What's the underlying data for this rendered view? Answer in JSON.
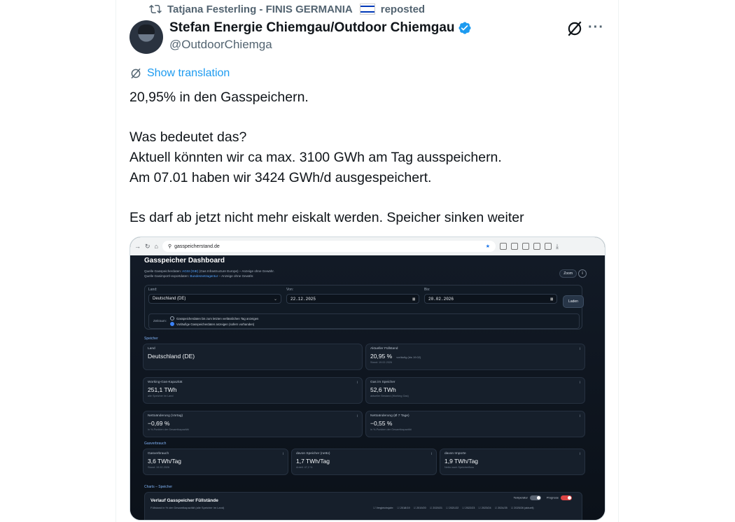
{
  "repost": {
    "text": "Tatjana Festerling - FINIS GERMANIA",
    "suffix": "reposted"
  },
  "author": {
    "name": "Stefan Energie Chiemgau/Outdoor Chiemgau",
    "handle": "@OutdoorChiemga"
  },
  "translate_label": "Show translation",
  "tweet": {
    "line1": "20,95% in den Gasspeichern.",
    "line2": "Was bedeutet das?",
    "line3": "Aktuell könnten wir ca max. 3100 GWh am Tag ausspeichern.",
    "line4": "Am 07.01 haben wir 3424 GWh/d ausgespeichert.",
    "line5": "Es darf ab jetzt nicht mehr eiskalt werden. Speicher sinken weiter"
  },
  "media": {
    "url": "gasspeicherstand.de",
    "dashboard": {
      "title": "Gasspeicher Dashboard",
      "source1_prefix": "Quelle Gasspeicherdaten:",
      "source1_link": "AGSI (GIE)",
      "source1_suffix": "(Gas Infrastructure Europe) – Anzeige ohne Gewähr.",
      "source2_prefix": "Quelle Gasimport/-exportdaten:",
      "source2_link": "Bundesnetzagentur",
      "source2_suffix": "– Anzeige ohne Gewähr.",
      "zoom": "Zoom",
      "filter": {
        "land_label": "Land:",
        "land_value": "Deutschland (DE)",
        "von_label": "Von:",
        "von_value": "22.12.2025",
        "bis_label": "Bis:",
        "bis_value": "20.02.2026",
        "load": "Laden",
        "zeitraum": "Zeitraum:",
        "opt1": "Gasspeicherdaten bis zum letzten verlässlichen Tag anzeigen",
        "opt2": "Vorläufige Gasspeicherdaten anzeigen (sofern vorhanden)"
      },
      "section_speicher": "Speicher",
      "cards": [
        {
          "title": "Land",
          "value": "Deutschland (DE)",
          "sub": ""
        },
        {
          "title": "Aktueller Füllstand",
          "value": "20,95 %",
          "note": "vorläufig (bis 19.02)",
          "sub": "Stand: 19.02.2026"
        },
        {
          "title": "Working-Gas-Kapazität",
          "value": "251,1 TWh",
          "sub": "alle Speicher im Land"
        },
        {
          "title": "Gas im Speicher",
          "value": "52,6 TWh",
          "sub": "aktueller Bestand (Working Gas)"
        },
        {
          "title": "Nettoänderung (Vortag)",
          "value": "−0,69 %",
          "sub": "in %-Punkten der Gesamtkapazität"
        },
        {
          "title": "Nettoänderung (Ø 7 Tage)",
          "value": "−0,55 %",
          "sub": "in %-Punkten der Gesamtkapazität"
        }
      ],
      "section_verbrauch": "Gasverbrauch",
      "cards2": [
        {
          "title": "Gasverbrauch",
          "value": "3,6 TWh/Tag",
          "sub": "Stand: 19.02.2026"
        },
        {
          "title": "davon Speicher (netto)",
          "value": "1,7 TWh/Tag",
          "sub": "Anteil: 47,2 %"
        },
        {
          "title": "davon Importe",
          "value": "1,9 TWh/Tag",
          "sub": "Netto nach Speicherfluss"
        }
      ],
      "section_charts": "Charts – Speicher",
      "chart": {
        "title": "Verlauf Gasspeicher Füllstände",
        "subtitle": "Füllstand in % der Gesamtkapazität (alle Speicher im Land)",
        "toggle1": "Temperatur",
        "toggle2": "Prognose",
        "compare_label": "Vergleichsjahr:",
        "years": [
          "2018/19",
          "2019/20",
          "2020/21",
          "2021/22",
          "2022/23",
          "2023/24",
          "2024/25",
          "2025/26 (aktuell)"
        ]
      }
    }
  }
}
